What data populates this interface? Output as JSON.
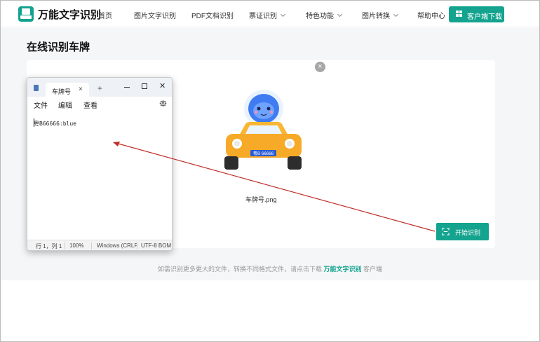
{
  "nav": {
    "brand": "万能文字识别",
    "items": [
      "首页",
      "图片文字识别",
      "PDF文档识别",
      "票证识别",
      "特色功能",
      "图片转换",
      "帮助中心"
    ],
    "download_label": "客户端下载"
  },
  "page": {
    "title": "在线识别车牌",
    "close_glyph": "×",
    "filename": "车牌号.png",
    "plate_text": "粤B 66666",
    "start_label": "开始识别",
    "footer": {
      "prefix": "如需识别更多更大的文件，转换不同格式文件，请点击下载",
      "brand": "万能文字识别",
      "suffix": "客户端"
    }
  },
  "notepad": {
    "tab_title": "车牌号",
    "tab_close": "×",
    "new_tab": "+",
    "close_glyph": "✕",
    "menu": [
      "文件",
      "编辑",
      "查看"
    ],
    "content": "粤B66666:blue",
    "status": [
      "行 1，列 1",
      "100%",
      "Windows (CRLF",
      "UTF-8 BOM"
    ]
  },
  "colors": {
    "accent": "#13a38e",
    "annotation_arrow": "#c0302b"
  }
}
